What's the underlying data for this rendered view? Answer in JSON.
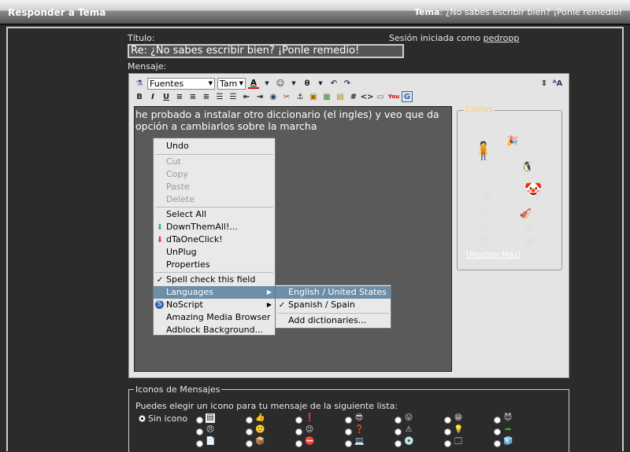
{
  "header": {
    "title": "Responder a Tema",
    "topic_label": "Tema",
    "topic_value": "¿No sabes escribir bien? ¡Ponle remedio!"
  },
  "form": {
    "title_label": "Título:",
    "title_value": "Re: ¿No sabes escribir bien?  ¡Ponle remedio!",
    "session_text": "Sesión iniciada como",
    "session_user": "pedropp",
    "message_label": "Mensaje:"
  },
  "toolbar": {
    "font_select": "Fuentes",
    "size_select": "Tam"
  },
  "message": {
    "text": "he probado a instalar otro diccionario (el ingles)  y veo que da opción a cambiarlos sobre la marcha"
  },
  "cantos": {
    "legend": "Cantas",
    "show_more": "[Mostrar Más]"
  },
  "context_menu": {
    "items": [
      {
        "label": "Undo",
        "enabled": true
      },
      {
        "label": "Cut",
        "enabled": false
      },
      {
        "label": "Copy",
        "enabled": false
      },
      {
        "label": "Paste",
        "enabled": false
      },
      {
        "label": "Delete",
        "enabled": false
      },
      {
        "label": "Select All",
        "enabled": true
      },
      {
        "label": "DownThemAll!...",
        "enabled": true
      },
      {
        "label": "dTaOneClick!",
        "enabled": true
      },
      {
        "label": "UnPlug",
        "enabled": true
      },
      {
        "label": "Properties",
        "enabled": true
      },
      {
        "label": "Spell check this field",
        "enabled": true,
        "checked": true
      },
      {
        "label": "Languages",
        "enabled": true,
        "highlighted": true
      },
      {
        "label": "NoScript",
        "enabled": true
      },
      {
        "label": "Amazing Media Browser",
        "enabled": true
      },
      {
        "label": "Adblock Background...",
        "enabled": true
      }
    ]
  },
  "languages_menu": {
    "items": [
      {
        "label": "English / United States",
        "highlighted": true
      },
      {
        "label": "Spanish / Spain",
        "checked": true
      },
      {
        "label": "Add dictionaries..."
      }
    ]
  },
  "icons_section": {
    "legend": "Iconos de Mensajes",
    "instruction": "Puedes elegir un icono para tu mensaje de la siguiente lista:",
    "none_label": "Sin icono"
  },
  "colors": {
    "highlight": "#6c8ea9",
    "textarea_bg": "#5a5a5a"
  }
}
